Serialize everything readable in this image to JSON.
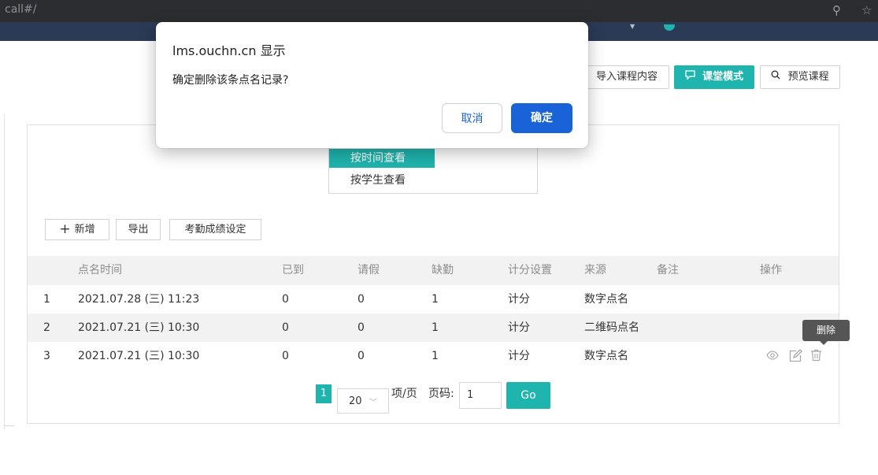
{
  "browser": {
    "url_fragment": "call#/",
    "search_glyph": "⚲",
    "star_glyph": "☆"
  },
  "header_actions": {
    "import_label": "导入课程内容",
    "classroom_label": "课堂模式",
    "classroom_icon": "chat-icon",
    "preview_label": "预览课程",
    "preview_icon": "search-icon"
  },
  "view_menu": {
    "items": [
      "按时间查看",
      "按学生查看"
    ],
    "selected": "按时间查看"
  },
  "toolbar": {
    "add_label": "新增",
    "export_label": "导出",
    "attendance_settings_label": "考勤成绩设定"
  },
  "table": {
    "headers": [
      "",
      "点名时间",
      "已到",
      "请假",
      "缺勤",
      "计分设置",
      "来源",
      "备注",
      "操作"
    ],
    "rows": [
      {
        "index": "1",
        "time": "2021.07.28 (三) 11:23",
        "present": "0",
        "leave": "0",
        "absent": "1",
        "scoring": "计分",
        "source": "数字点名",
        "note": ""
      },
      {
        "index": "2",
        "time": "2021.07.21 (三) 10:30",
        "present": "0",
        "leave": "0",
        "absent": "1",
        "scoring": "计分",
        "source": "二维码点名",
        "note": ""
      },
      {
        "index": "3",
        "time": "2021.07.21 (三) 10:30",
        "present": "0",
        "leave": "0",
        "absent": "1",
        "scoring": "计分",
        "source": "数字点名",
        "note": ""
      }
    ]
  },
  "tooltip": {
    "text": "删除"
  },
  "pagination": {
    "current_page": "1",
    "page_size": "20",
    "per_page_label": "项/页",
    "page_label": "页码:",
    "page_input": "1",
    "go_label": "Go"
  },
  "dialog": {
    "title": "lms.ouchn.cn 显示",
    "message": "确定删除该条点名记录?",
    "cancel_label": "取消",
    "ok_label": "确定"
  },
  "colors": {
    "accent": "#1fb4ad",
    "dialog_primary": "#1a62d8",
    "row_stripe": "#f2f2f2"
  }
}
